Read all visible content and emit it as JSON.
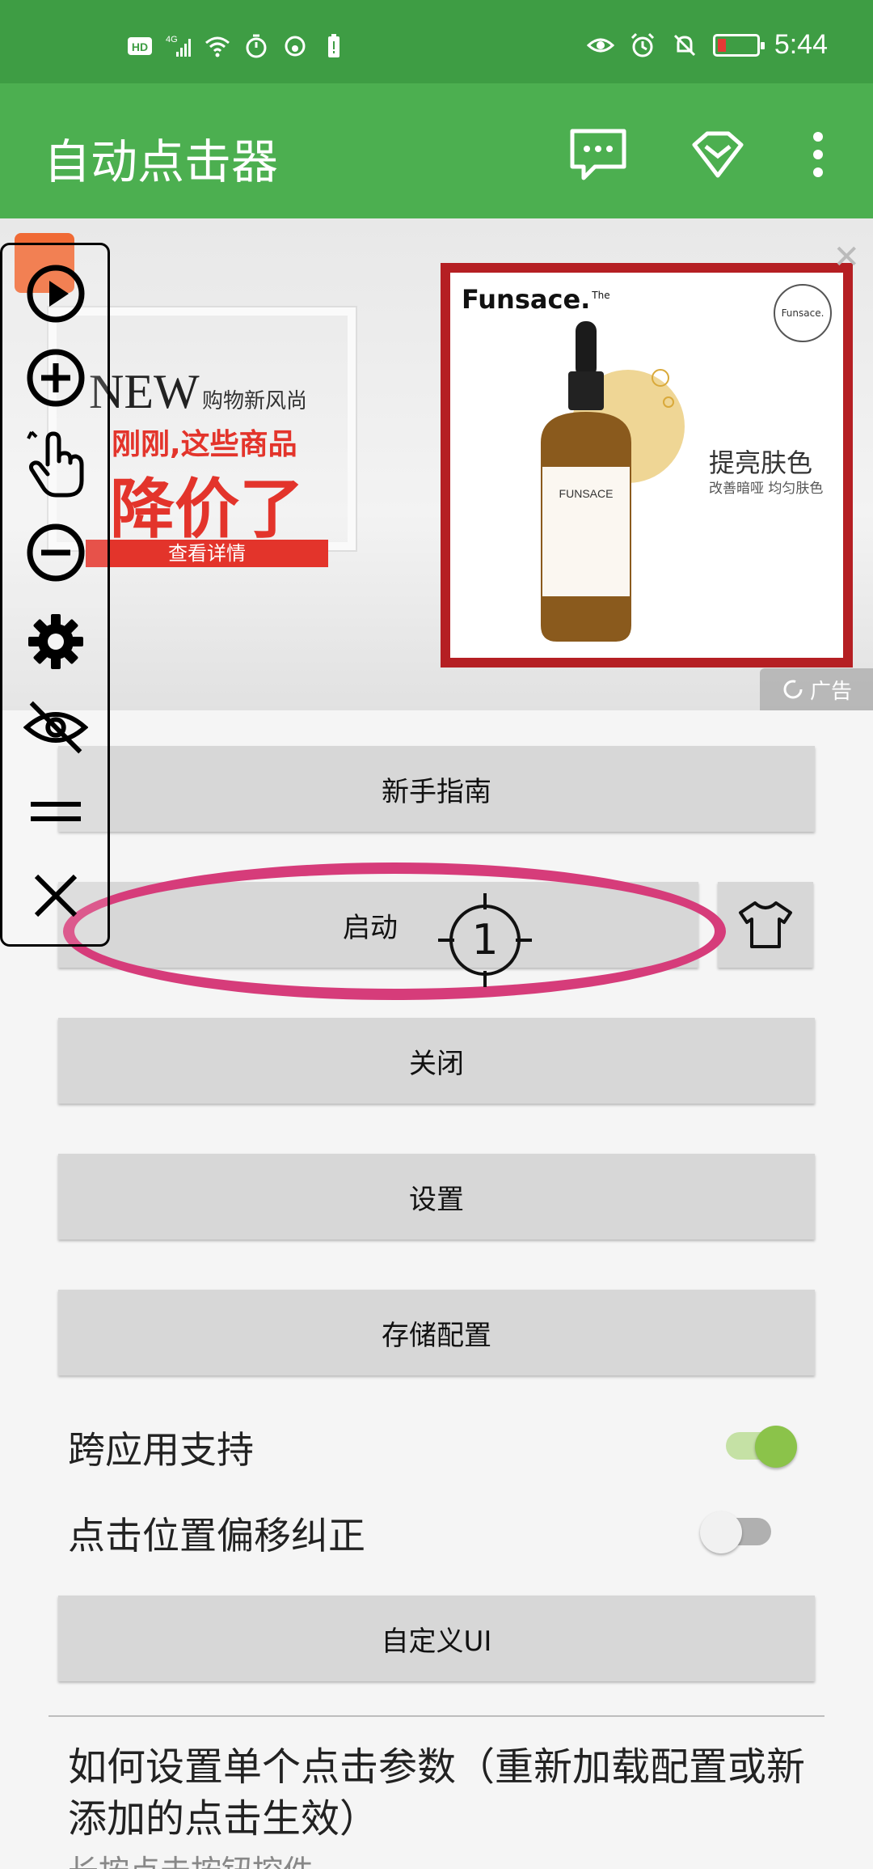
{
  "status_bar": {
    "left_icons": [
      "hd-icon",
      "4g-signal-icon",
      "wifi-icon",
      "timer-icon",
      "sync-icon",
      "battery-alert-icon"
    ],
    "right_icons": [
      "eye-icon",
      "alarm-icon",
      "mute-bell-icon",
      "battery-icon"
    ],
    "time": "5:44"
  },
  "app_bar": {
    "title": "自动点击器",
    "actions": [
      "chat-icon",
      "diamond-icon",
      "more-vert-icon"
    ]
  },
  "ad": {
    "headline_new": "NEW",
    "headline_sub": "购物新风尚",
    "line1": "刚刚,这些商品",
    "line2": "降价了",
    "details_button": "查看详情",
    "brand": "Funsace.",
    "brand_small": "The",
    "seal_text": "Funsace.",
    "promo_title": "提亮肤色",
    "promo_sub": "改善暗哑 均匀肤色",
    "product_label": "FUNSACE",
    "ad_tag": "广告"
  },
  "buttons": {
    "guide": "新手指南",
    "start": "启动",
    "stop": "关闭",
    "settings": "设置",
    "save_config": "存储配置",
    "custom_ui": "自定义UI"
  },
  "toggles": [
    {
      "label": "跨应用支持",
      "on": true
    },
    {
      "label": "点击位置偏移纠正",
      "on": false
    }
  ],
  "help": {
    "title": "如何设置单个点击参数（重新加载配置或新添加的点击生效）",
    "subtitle": "长按点击按钮控件"
  },
  "floating_toolbar": {
    "tools": [
      "play-icon",
      "add-circle-icon",
      "tap-gesture-icon",
      "remove-circle-icon",
      "gear-icon",
      "eye-off-icon",
      "drag-handle-icon",
      "close-icon"
    ]
  },
  "click_target": {
    "number": "1"
  },
  "colors": {
    "status_bar": "#3e9d44",
    "app_bar": "#4caf50",
    "toggle_on": "#8bc34a",
    "ellipse": "#d63c7a"
  }
}
